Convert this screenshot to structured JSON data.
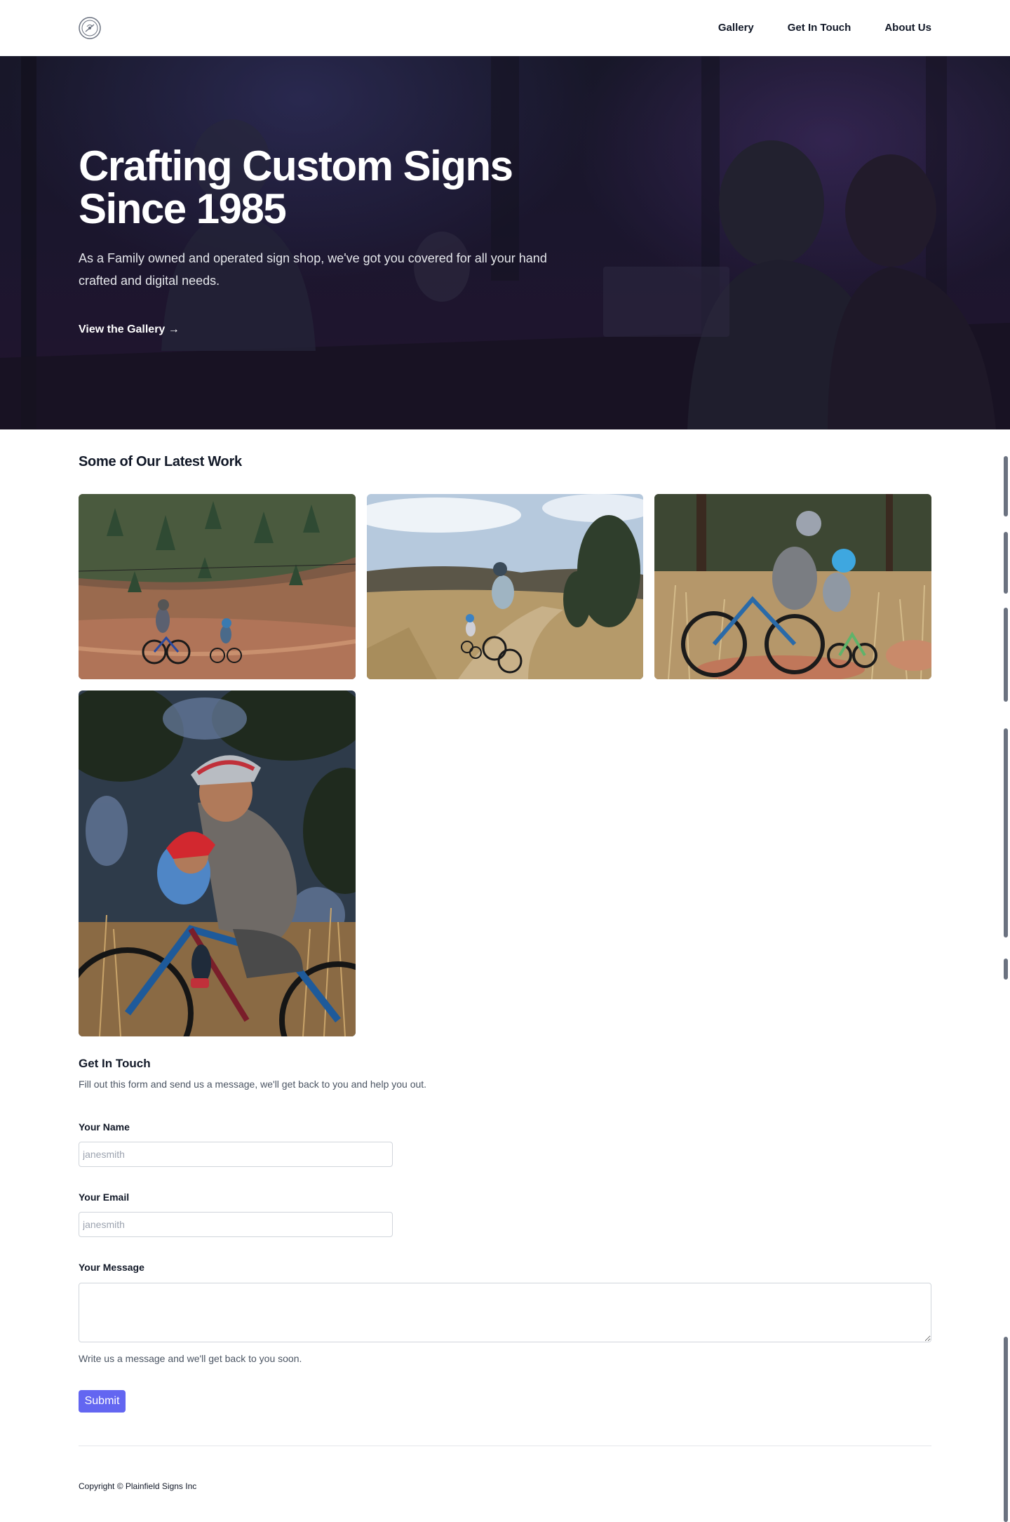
{
  "nav": {
    "logo_alt": "Plainfield Signs logo",
    "links": [
      "Gallery",
      "Get In Touch",
      "About Us"
    ]
  },
  "hero": {
    "title_line1": "Crafting Custom Signs",
    "title_line2": "Since 1985",
    "subtitle": "As a Family owned and operated sign shop, we've got you covered for all your hand crafted and digital needs.",
    "cta": "View the Gallery →"
  },
  "work": {
    "title": "Some of Our Latest Work",
    "photos": [
      "mountain-bike-hillside-photo",
      "trail-ride-sky-photo",
      "father-child-bikes-photo",
      "tandem-ride-closeup-photo"
    ]
  },
  "contact": {
    "title": "Get In Touch",
    "description": "Fill out this form and send us a message, we'll get back to you and help you out.",
    "name_label": "Your Name",
    "name_placeholder": "janesmith",
    "email_label": "Your Email",
    "email_placeholder": "janesmith",
    "message_label": "Your Message",
    "message_help": "Write us a message and we'll get back to you soon.",
    "submit_label": "Submit"
  },
  "footer": {
    "copyright": "Copyright © Plainfield Signs Inc"
  },
  "colors": {
    "accent": "#6366f1",
    "hero_overlay": "#201a36"
  }
}
